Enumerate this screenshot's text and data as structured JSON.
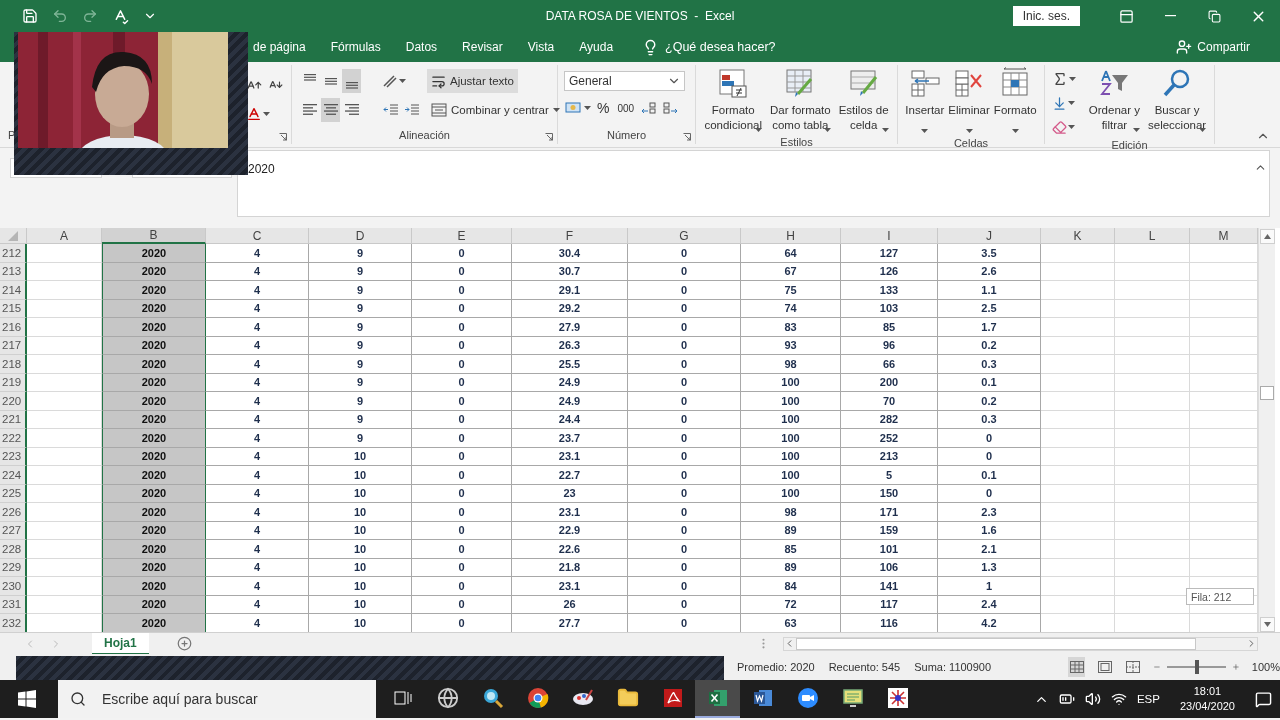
{
  "title_bar": {
    "title": "DATA ROSA DE VIENTOS  -  Excel",
    "sign_in": "Inic. ses."
  },
  "ribbon_tabs": [
    {
      "label": "de página"
    },
    {
      "label": "Fórmulas"
    },
    {
      "label": "Datos"
    },
    {
      "label": "Revisar"
    },
    {
      "label": "Vista"
    },
    {
      "label": "Ayuda"
    }
  ],
  "tell_me": "¿Qué desea hacer?",
  "share": "Compartir",
  "ribbon_groups": [
    {
      "kind": "clipboard",
      "label": "P"
    },
    {
      "kind": "font"
    },
    {
      "kind": "alignment",
      "label": "Alineación",
      "vertical_align": [
        {
          "selected": false
        },
        {
          "selected": false
        },
        {
          "selected": true
        }
      ],
      "horizontal_align": [
        {
          "selected": false
        },
        {
          "selected": true
        },
        {
          "selected": false
        }
      ],
      "wrap_text": {
        "label": "Ajustar texto",
        "on": true
      },
      "merge": "Combinar y centrar"
    },
    {
      "kind": "number",
      "label": "Número",
      "format": "General",
      "buttons": [
        "%",
        "000"
      ]
    },
    {
      "kind": "styles",
      "label": "Estilos",
      "buttons": [
        {
          "lines": [
            "Formato",
            "condicional"
          ]
        },
        {
          "lines": [
            "Dar formato",
            "como tabla"
          ]
        },
        {
          "lines": [
            "Estilos de",
            "celda"
          ]
        }
      ]
    },
    {
      "kind": "cells",
      "label": "Celdas",
      "buttons": [
        {
          "lines": [
            "Insertar"
          ]
        },
        {
          "lines": [
            "Eliminar"
          ]
        },
        {
          "lines": [
            "Formato"
          ]
        }
      ]
    },
    {
      "kind": "editing",
      "label": "Edición",
      "buttons": [
        {
          "lines": [
            "Ordenar y",
            "filtrar"
          ]
        },
        {
          "lines": [
            "Buscar y",
            "seleccionar"
          ]
        }
      ]
    }
  ],
  "formula_bar": {
    "value": "2020"
  },
  "sheet": {
    "columns": [
      {
        "letter": "A",
        "selected": false
      },
      {
        "letter": "B",
        "selected": true
      },
      {
        "letter": "C",
        "selected": false
      },
      {
        "letter": "D",
        "selected": false
      },
      {
        "letter": "E",
        "selected": false
      },
      {
        "letter": "F",
        "selected": false
      },
      {
        "letter": "G",
        "selected": false
      },
      {
        "letter": "H",
        "selected": false
      },
      {
        "letter": "I",
        "selected": false
      },
      {
        "letter": "J",
        "selected": false
      },
      {
        "letter": "K",
        "selected": false
      },
      {
        "letter": "L",
        "selected": false
      },
      {
        "letter": "M",
        "selected": false
      }
    ],
    "rows": [
      {
        "number": "212",
        "cells": [
          "",
          "2020",
          "4",
          "9",
          "0",
          "30.4",
          "0",
          "64",
          "127",
          "3.5"
        ]
      },
      {
        "number": "213",
        "cells": [
          "",
          "2020",
          "4",
          "9",
          "0",
          "30.7",
          "0",
          "67",
          "126",
          "2.6"
        ]
      },
      {
        "number": "214",
        "cells": [
          "",
          "2020",
          "4",
          "9",
          "0",
          "29.1",
          "0",
          "75",
          "133",
          "1.1"
        ]
      },
      {
        "number": "215",
        "cells": [
          "",
          "2020",
          "4",
          "9",
          "0",
          "29.2",
          "0",
          "74",
          "103",
          "2.5"
        ]
      },
      {
        "number": "216",
        "cells": [
          "",
          "2020",
          "4",
          "9",
          "0",
          "27.9",
          "0",
          "83",
          "85",
          "1.7"
        ]
      },
      {
        "number": "217",
        "cells": [
          "",
          "2020",
          "4",
          "9",
          "0",
          "26.3",
          "0",
          "93",
          "96",
          "0.2"
        ]
      },
      {
        "number": "218",
        "cells": [
          "",
          "2020",
          "4",
          "9",
          "0",
          "25.5",
          "0",
          "98",
          "66",
          "0.3"
        ]
      },
      {
        "number": "219",
        "cells": [
          "",
          "2020",
          "4",
          "9",
          "0",
          "24.9",
          "0",
          "100",
          "200",
          "0.1"
        ]
      },
      {
        "number": "220",
        "cells": [
          "",
          "2020",
          "4",
          "9",
          "0",
          "24.9",
          "0",
          "100",
          "70",
          "0.2"
        ]
      },
      {
        "number": "221",
        "cells": [
          "",
          "2020",
          "4",
          "9",
          "0",
          "24.4",
          "0",
          "100",
          "282",
          "0.3"
        ]
      },
      {
        "number": "222",
        "cells": [
          "",
          "2020",
          "4",
          "9",
          "0",
          "23.7",
          "0",
          "100",
          "252",
          "0"
        ]
      },
      {
        "number": "223",
        "cells": [
          "",
          "2020",
          "4",
          "10",
          "0",
          "23.1",
          "0",
          "100",
          "213",
          "0"
        ]
      },
      {
        "number": "224",
        "cells": [
          "",
          "2020",
          "4",
          "10",
          "0",
          "22.7",
          "0",
          "100",
          "5",
          "0.1"
        ]
      },
      {
        "number": "225",
        "cells": [
          "",
          "2020",
          "4",
          "10",
          "0",
          "23",
          "0",
          "100",
          "150",
          "0"
        ]
      },
      {
        "number": "226",
        "cells": [
          "",
          "2020",
          "4",
          "10",
          "0",
          "23.1",
          "0",
          "98",
          "171",
          "2.3"
        ]
      },
      {
        "number": "227",
        "cells": [
          "",
          "2020",
          "4",
          "10",
          "0",
          "22.9",
          "0",
          "89",
          "159",
          "1.6"
        ]
      },
      {
        "number": "228",
        "cells": [
          "",
          "2020",
          "4",
          "10",
          "0",
          "22.6",
          "0",
          "85",
          "101",
          "2.1"
        ]
      },
      {
        "number": "229",
        "cells": [
          "",
          "2020",
          "4",
          "10",
          "0",
          "21.8",
          "0",
          "89",
          "106",
          "1.3"
        ]
      },
      {
        "number": "230",
        "cells": [
          "",
          "2020",
          "4",
          "10",
          "0",
          "23.1",
          "0",
          "84",
          "141",
          "1"
        ]
      },
      {
        "number": "231",
        "cells": [
          "",
          "2020",
          "4",
          "10",
          "0",
          "26",
          "0",
          "72",
          "117",
          "2.4"
        ]
      },
      {
        "number": "232",
        "cells": [
          "",
          "2020",
          "4",
          "10",
          "0",
          "27.7",
          "0",
          "63",
          "116",
          "4.2"
        ]
      }
    ]
  },
  "tooltip": "Fila: 212",
  "sheet_tabs": [
    {
      "label": "Hoja1",
      "selected": true
    }
  ],
  "status_bar": {
    "stats": [
      "Promedio: 2020",
      "Recuento: 545",
      "Suma: 1100900"
    ],
    "views": [
      {
        "selected": true
      },
      {
        "selected": false
      },
      {
        "selected": false
      }
    ],
    "zoom": {
      "level": 0.5,
      "reading": "100%"
    }
  },
  "taskbar": {
    "search_placeholder": "Escribe aquí para buscar",
    "apps": [
      {
        "active": false
      },
      {
        "active": false
      },
      {
        "active": false
      },
      {
        "active": false
      },
      {
        "active": false
      },
      {
        "active": false
      },
      {
        "active": false
      },
      {
        "active": true
      },
      {
        "active": false
      },
      {
        "active": false
      },
      {
        "active": false
      },
      {
        "active": false
      }
    ],
    "language": "ESP",
    "time": "18:01",
    "date": "23/04/2020"
  }
}
